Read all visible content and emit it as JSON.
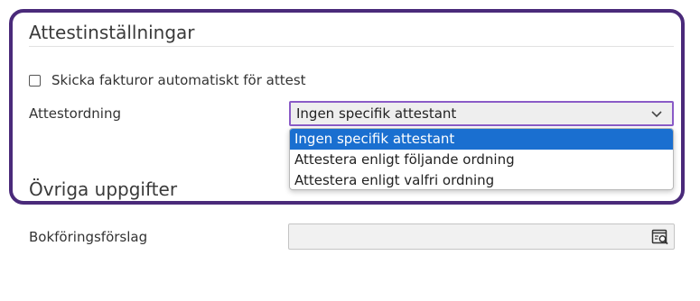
{
  "attest": {
    "title": "Attestinställningar",
    "auto_send_label": "Skicka fakturor automatiskt för attest",
    "auto_send_checked": false,
    "order_label": "Attestordning",
    "order_selected": "Ingen specifik attestant",
    "order_options": [
      "Ingen specifik attestant",
      "Attestera enligt följande ordning",
      "Attestera enligt valfri ordning"
    ]
  },
  "other": {
    "title": "Övriga uppgifter",
    "bookkeeping_label": "Bokföringsförslag",
    "bookkeeping_value": ""
  },
  "colors": {
    "highlight_frame": "#4a2a7a",
    "select_focus_border": "#8a5bc7",
    "option_selected_bg": "#1a6fd0"
  },
  "icons": {
    "select_chevron": "chevron-down-icon",
    "lookup": "document-search-icon"
  }
}
